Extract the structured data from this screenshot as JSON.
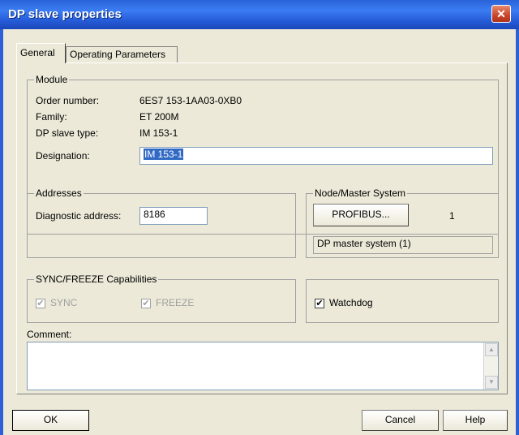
{
  "window": {
    "title": "DP slave properties"
  },
  "tabs": [
    {
      "label": "General",
      "active": true
    },
    {
      "label": "Operating Parameters",
      "active": false
    }
  ],
  "module": {
    "group_title": "Module",
    "order_number_label": "Order number:",
    "order_number_value": "6ES7 153-1AA03-0XB0",
    "family_label": "Family:",
    "family_value": "ET 200M",
    "dp_slave_type_label": "DP slave type:",
    "dp_slave_type_value": "IM 153-1",
    "designation_label": "Designation:",
    "designation_value": "IM 153-1"
  },
  "addresses": {
    "group_title": "Addresses",
    "diagnostic_label": "Diagnostic address:",
    "diagnostic_value": "8186"
  },
  "node_master": {
    "group_title": "Node/Master System",
    "profibus_button": "PROFIBUS...",
    "node_number": "1",
    "master_system": "DP master system (1)"
  },
  "sync_freeze": {
    "group_title": "SYNC/FREEZE Capabilities",
    "sync_label": "SYNC",
    "freeze_label": "FREEZE",
    "sync_checked": true,
    "freeze_checked": true
  },
  "watchdog": {
    "label": "Watchdog",
    "checked": true
  },
  "comment": {
    "label": "Comment:",
    "value": ""
  },
  "buttons": {
    "ok": "OK",
    "cancel": "Cancel",
    "help": "Help"
  },
  "glyphs": {
    "close": "✕",
    "check": "✔",
    "scroll_up": "▲",
    "scroll_down": "▼"
  }
}
